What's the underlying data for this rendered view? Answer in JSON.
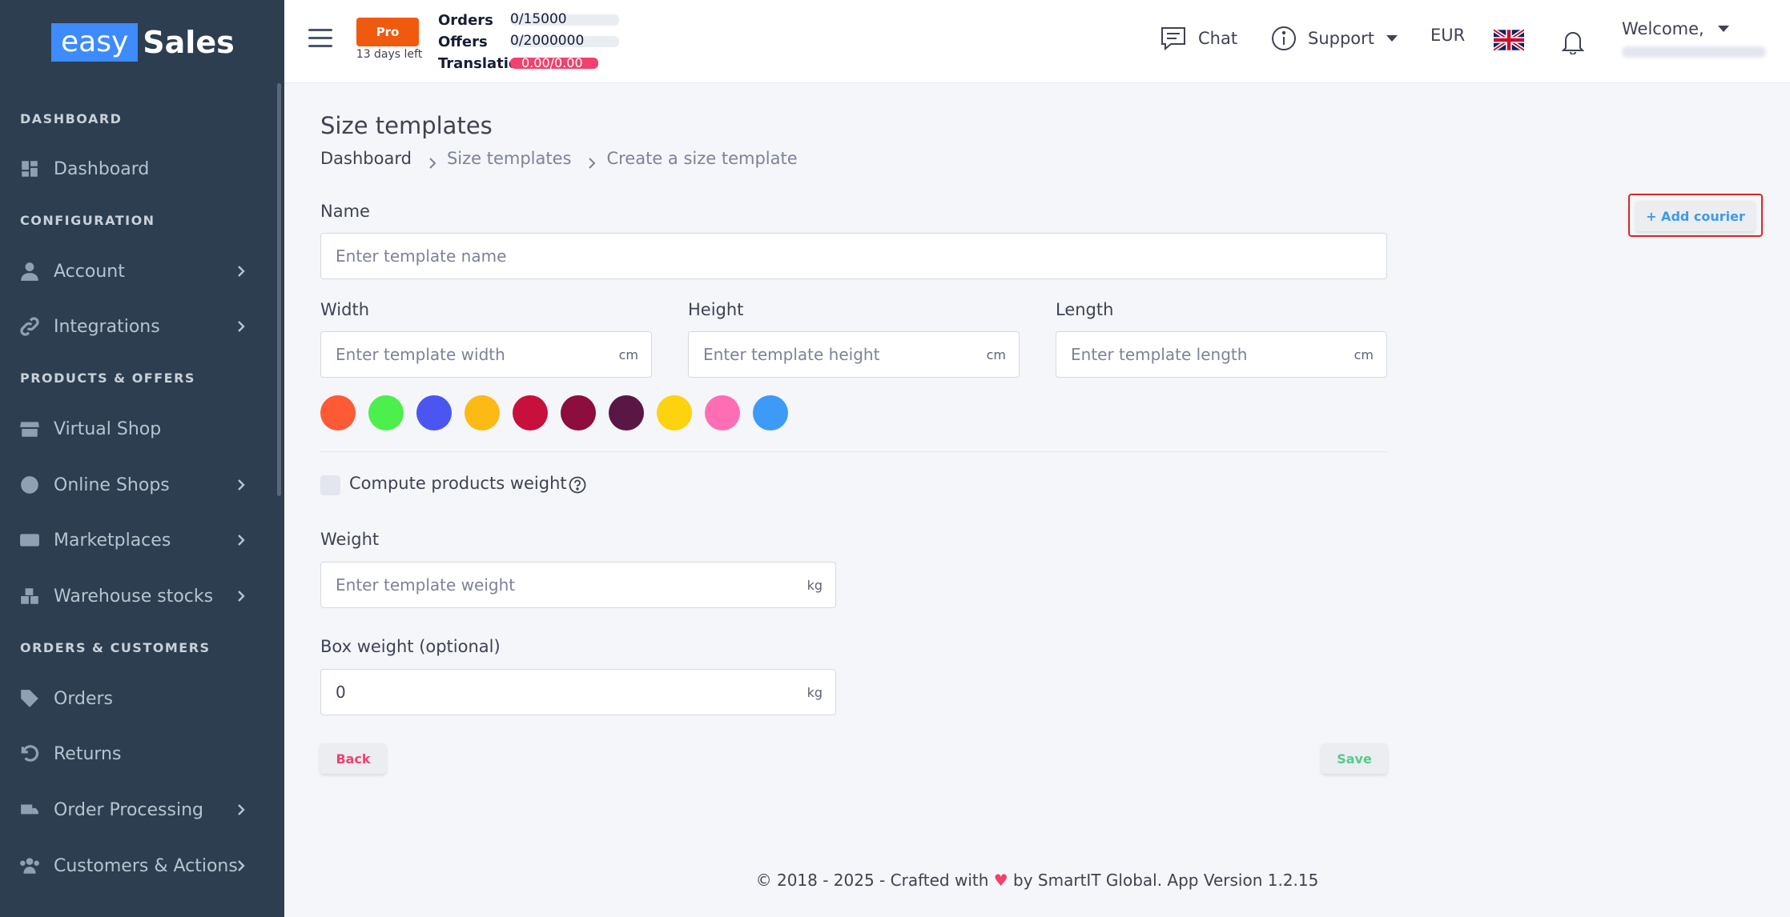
{
  "brand": {
    "easy": "easy",
    "sales": "Sales"
  },
  "sidebar": {
    "sections": [
      {
        "label": "DASHBOARD"
      },
      {
        "label": "CONFIGURATION"
      },
      {
        "label": "PRODUCTS & OFFERS"
      },
      {
        "label": "ORDERS & CUSTOMERS"
      }
    ],
    "items": [
      {
        "label": "Dashboard",
        "icon": "dashboard-icon"
      },
      {
        "label": "Account",
        "icon": "user-icon"
      },
      {
        "label": "Integrations",
        "icon": "link-icon"
      },
      {
        "label": "Virtual Shop",
        "icon": "store-icon"
      },
      {
        "label": "Online Shops",
        "icon": "globe-icon"
      },
      {
        "label": "Marketplaces",
        "icon": "money-icon"
      },
      {
        "label": "Warehouse stocks",
        "icon": "boxes-icon"
      },
      {
        "label": "Orders",
        "icon": "tags-icon"
      },
      {
        "label": "Returns",
        "icon": "undo-icon"
      },
      {
        "label": "Order Processing",
        "icon": "truck-icon"
      },
      {
        "label": "Customers & Actions",
        "icon": "users-icon"
      }
    ]
  },
  "header": {
    "plan": "Pro",
    "days_left": "13 days left",
    "quotas": [
      {
        "label": "Orders",
        "value": "0/15000"
      },
      {
        "label": "Offers",
        "value": "0/2000000"
      },
      {
        "label": "Translations",
        "value": "0.00/0.00"
      }
    ],
    "chat": "Chat",
    "support": "Support",
    "currency": "EUR",
    "welcome": "Welcome,"
  },
  "page": {
    "title": "Size templates",
    "breadcrumb": [
      "Dashboard",
      "Size templates",
      "Create a size template"
    ]
  },
  "form": {
    "name_label": "Name",
    "name_placeholder": "Enter template name",
    "width_label": "Width",
    "width_placeholder": "Enter template width",
    "height_label": "Height",
    "height_placeholder": "Enter template height",
    "length_label": "Length",
    "length_placeholder": "Enter template length",
    "dim_unit": "cm",
    "colors": [
      "#ff5a36",
      "#4cef4c",
      "#4b55f2",
      "#fdba14",
      "#c8103c",
      "#8c0d3e",
      "#5a1745",
      "#fdd20f",
      "#ff6eb4",
      "#3d9bf7"
    ],
    "compute_weight_label": "Compute products weight",
    "weight_label": "Weight",
    "weight_placeholder": "Enter template weight",
    "weight_unit": "kg",
    "box_weight_label": "Box weight (optional)",
    "box_weight_value": "0",
    "box_weight_unit": "kg",
    "back": "Back",
    "save": "Save",
    "add_courier": "+ Add courier"
  },
  "footer": {
    "before": "© 2018 - 2025 - Crafted with",
    "heart": "♥",
    "after": "by SmartIT Global. App Version 1.2.15"
  }
}
